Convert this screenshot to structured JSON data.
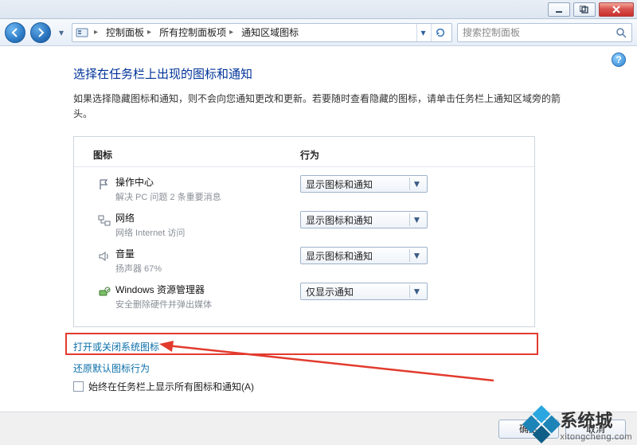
{
  "titlebar": {
    "minimize_icon": "minimize-icon",
    "maximize_icon": "maximize-icon",
    "close_icon": "close-icon"
  },
  "nav": {
    "back_icon": "back-arrow-icon",
    "forward_icon": "forward-arrow-icon"
  },
  "breadcrumb": {
    "item0": "控制面板",
    "item1": "所有控制面板项",
    "item2": "通知区域图标"
  },
  "search": {
    "placeholder": "搜索控制面板"
  },
  "help_label": "?",
  "page": {
    "title": "选择在任务栏上出现的图标和通知",
    "desc": "如果选择隐藏图标和通知，则不会向您通知更改和更新。若要随时查看隐藏的图标，请单击任务栏上通知区域旁的箭头。"
  },
  "table": {
    "head_icon": "图标",
    "head_action": "行为",
    "rows": [
      {
        "name": "操作中心",
        "sub": "解决 PC 问题  2 条重要消息",
        "value": "显示图标和通知",
        "icon": "flag-icon"
      },
      {
        "name": "网络",
        "sub": "网络 Internet 访问",
        "value": "显示图标和通知",
        "icon": "network-icon"
      },
      {
        "name": "音量",
        "sub": "扬声器 67%",
        "value": "显示图标和通知",
        "icon": "speaker-icon"
      },
      {
        "name": "Windows 资源管理器",
        "sub": "安全删除硬件并弹出媒体",
        "value": "仅显示通知",
        "icon": "safely-remove-hardware-icon"
      }
    ]
  },
  "links": {
    "toggle_system_icons": "打开或关闭系统图标",
    "restore_defaults": "还原默认图标行为"
  },
  "checkbox": {
    "label": "始终在任务栏上显示所有图标和通知(A)"
  },
  "buttons": {
    "ok": "确定",
    "cancel": "取消"
  },
  "watermark": {
    "brand": "系统城",
    "url": "xitongcheng.com"
  }
}
